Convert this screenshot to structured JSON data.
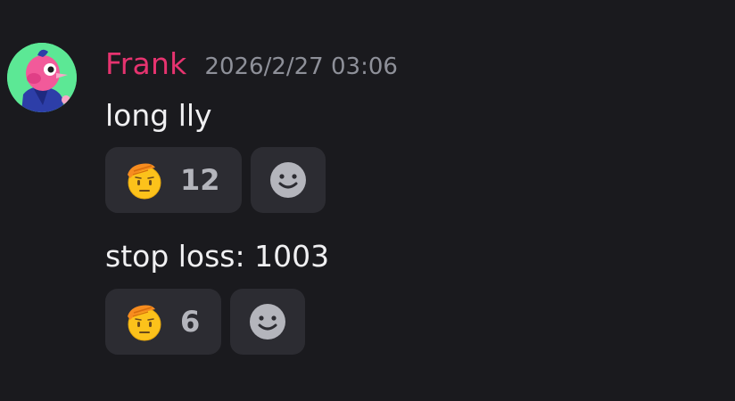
{
  "message": {
    "author": "Frank",
    "timestamp": "2026/2/27 03:06",
    "author_color": "#e6336f",
    "avatar": "pink-bird-avatar"
  },
  "messages": [
    {
      "text": "long lly",
      "reactions": [
        {
          "emoji": "saluting-face-icon",
          "count": "12"
        }
      ]
    },
    {
      "text": "stop loss: 1003",
      "reactions": [
        {
          "emoji": "saluting-face-icon",
          "count": "6"
        }
      ]
    }
  ],
  "add_reaction_icon": "add-reaction-smile-icon",
  "colors": {
    "background": "#1a1a1e",
    "pill": "#2c2c32",
    "text": "#f0f0f2",
    "muted": "#8e9099"
  }
}
